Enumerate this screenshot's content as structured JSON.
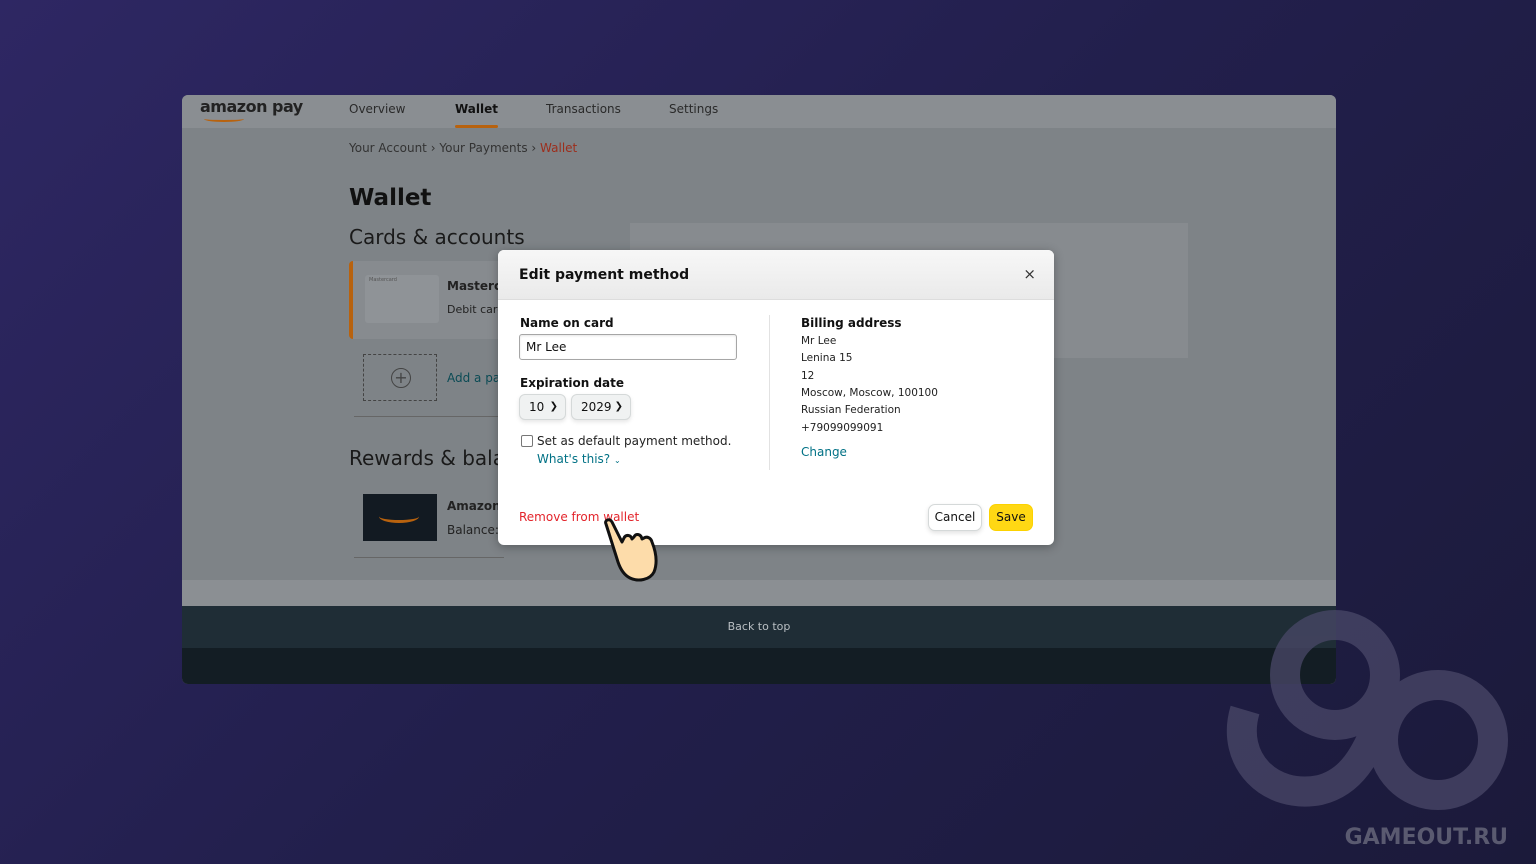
{
  "nav": {
    "logo": "amazon pay",
    "tabs": [
      {
        "label": "Overview"
      },
      {
        "label": "Wallet",
        "active": true
      },
      {
        "label": "Transactions"
      },
      {
        "label": "Settings"
      }
    ]
  },
  "breadcrumb": {
    "items": [
      "Your Account",
      "Your Payments"
    ],
    "separator": "›",
    "current": "Wallet"
  },
  "page": {
    "title": "Wallet",
    "cards_heading": "Cards & accounts",
    "card_name": "Masterca",
    "card_type": "Debit card",
    "card_brand_small": "Mastercard",
    "add_label": "Add a pa",
    "rewards_heading": "Rewards & bala",
    "gift_name": "Amazon",
    "gift_balance": "Balance:"
  },
  "footer": {
    "back_to_top": "Back to top"
  },
  "modal": {
    "title": "Edit payment method",
    "close": "×",
    "name_label": "Name on card",
    "name_value": "Mr Lee",
    "expiration_label": "Expiration date",
    "month": "10",
    "year": "2029",
    "default_label": "Set as default payment method.",
    "default_checked": false,
    "whats_this": "What's this?",
    "billing_label": "Billing address",
    "billing_lines": [
      "Mr Lee",
      "Lenina 15",
      "12",
      "Moscow, Moscow, 100100",
      "Russian Federation",
      "+79099099091"
    ],
    "change": "Change",
    "remove": "Remove from wallet",
    "cancel": "Cancel",
    "save": "Save"
  },
  "colors": {
    "accent": "#b8620e",
    "link": "#007185",
    "danger": "#e3242b",
    "save": "#ffd814"
  },
  "watermark": "GAMEOUT.RU"
}
